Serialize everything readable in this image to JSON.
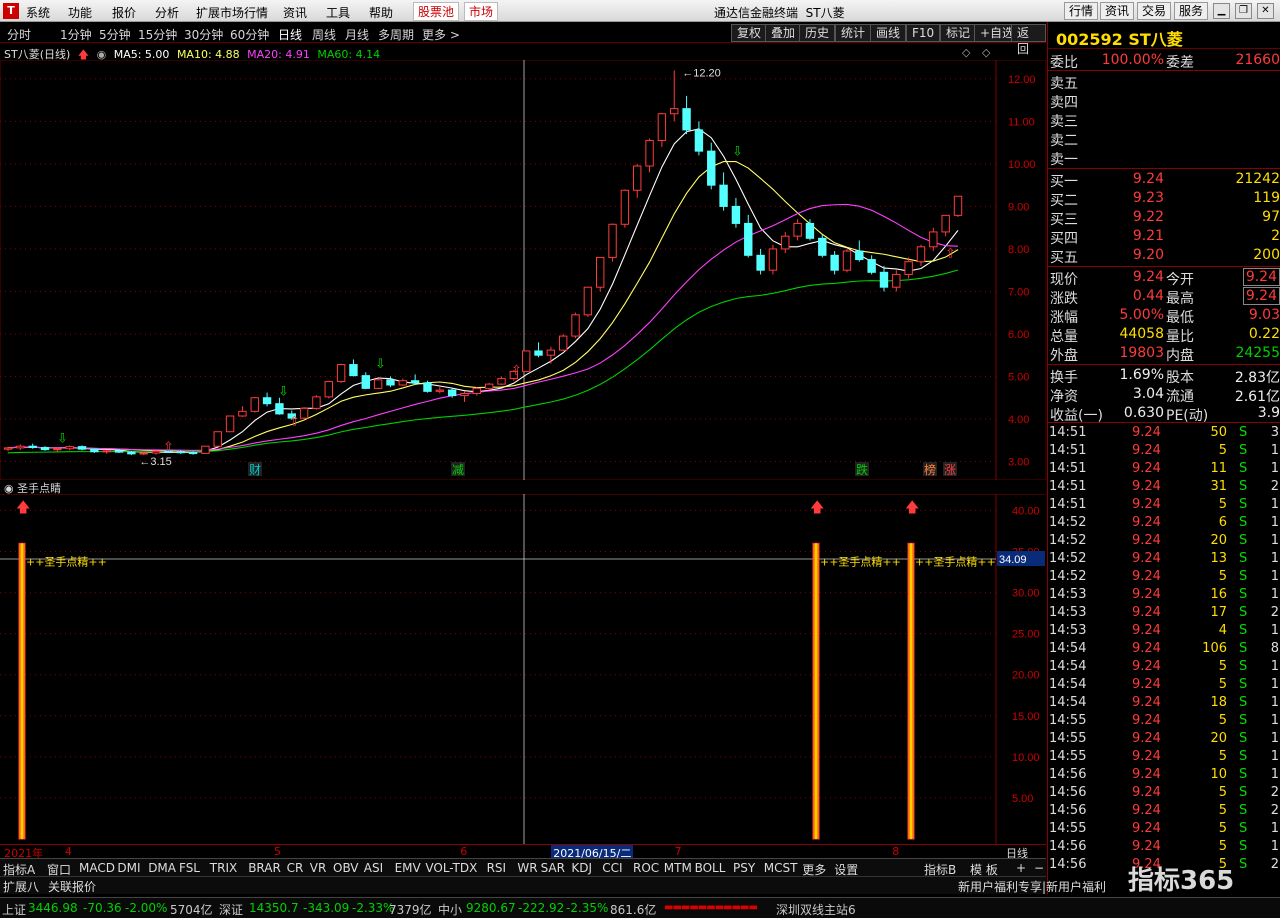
{
  "app": {
    "title": "通达信金融终端",
    "stock_name": "ST八菱"
  },
  "menu": [
    "系统",
    "功能",
    "报价",
    "分析",
    "扩展市场行情",
    "资讯",
    "工具",
    "帮助"
  ],
  "menu_red": [
    "股票池",
    "市场"
  ],
  "topbtns": [
    "行情",
    "资讯",
    "交易",
    "服务"
  ],
  "periods": [
    "分时",
    "1分钟",
    "5分钟",
    "15分钟",
    "30分钟",
    "60分钟",
    "日线",
    "周线",
    "月线",
    "多周期",
    "更多 >"
  ],
  "active_period": "日线",
  "toolbtns": [
    "复权",
    "叠加",
    "历史",
    "统计",
    "画线",
    "F10",
    "标记",
    "+自选",
    "返回"
  ],
  "chart_info": {
    "name": "ST八菱(日线)",
    "ma5": "MA5: 5.00",
    "ma10": "MA10: 4.88",
    "ma20": "MA20: 4.91",
    "ma60": "MA60: 4.14"
  },
  "colors": {
    "up": "#ff3b3b",
    "down": "#54ffff",
    "ma5": "#ffffff",
    "ma10": "#ffff64",
    "ma20": "#ff40ff",
    "ma60": "#00d000",
    "grid": "#800000"
  },
  "chart_data": {
    "type": "candlestick",
    "y_ticks": [
      12.0,
      11.0,
      10.0,
      9.0,
      8.0,
      7.0,
      6.0,
      5.0,
      4.0,
      3.0
    ],
    "ylim": [
      2.8,
      12.35
    ],
    "annotations": {
      "high": "12.20",
      "low": "3.15"
    },
    "event_labels": [
      "财",
      "减",
      "跌",
      "榜",
      "涨"
    ],
    "candles": [
      [
        3.29,
        3.35,
        3.24,
        3.32
      ],
      [
        3.32,
        3.4,
        3.27,
        3.36
      ],
      [
        3.36,
        3.42,
        3.3,
        3.33
      ],
      [
        3.33,
        3.36,
        3.25,
        3.28
      ],
      [
        3.28,
        3.33,
        3.22,
        3.3
      ],
      [
        3.3,
        3.38,
        3.26,
        3.35
      ],
      [
        3.35,
        3.38,
        3.26,
        3.29
      ],
      [
        3.29,
        3.31,
        3.2,
        3.23
      ],
      [
        3.23,
        3.27,
        3.18,
        3.25
      ],
      [
        3.25,
        3.3,
        3.2,
        3.22
      ],
      [
        3.22,
        3.25,
        3.15,
        3.18
      ],
      [
        3.18,
        3.22,
        3.15,
        3.2
      ],
      [
        3.2,
        3.26,
        3.16,
        3.24
      ],
      [
        3.24,
        3.28,
        3.2,
        3.23
      ],
      [
        3.23,
        3.26,
        3.18,
        3.21
      ],
      [
        3.21,
        3.24,
        3.16,
        3.19
      ],
      [
        3.19,
        3.36,
        3.19,
        3.36
      ],
      [
        3.36,
        3.7,
        3.36,
        3.7
      ],
      [
        3.7,
        4.07,
        3.7,
        4.07
      ],
      [
        4.07,
        4.3,
        4.05,
        4.18
      ],
      [
        4.18,
        4.52,
        4.15,
        4.5
      ],
      [
        4.5,
        4.62,
        4.3,
        4.36
      ],
      [
        4.36,
        4.5,
        4.1,
        4.12
      ],
      [
        4.12,
        4.2,
        3.98,
        4.02
      ],
      [
        4.02,
        4.28,
        4.0,
        4.25
      ],
      [
        4.25,
        4.56,
        4.22,
        4.52
      ],
      [
        4.52,
        4.9,
        4.48,
        4.88
      ],
      [
        4.88,
        5.3,
        4.85,
        5.28
      ],
      [
        5.28,
        5.4,
        5.0,
        5.02
      ],
      [
        5.02,
        5.1,
        4.7,
        4.72
      ],
      [
        4.72,
        4.95,
        4.7,
        4.92
      ],
      [
        4.92,
        5.0,
        4.75,
        4.8
      ],
      [
        4.8,
        4.95,
        4.78,
        4.9
      ],
      [
        4.9,
        5.05,
        4.8,
        4.85
      ],
      [
        4.85,
        4.9,
        4.62,
        4.65
      ],
      [
        4.65,
        4.75,
        4.6,
        4.68
      ],
      [
        4.68,
        4.72,
        4.5,
        4.55
      ],
      [
        4.55,
        4.65,
        4.4,
        4.6
      ],
      [
        4.6,
        4.75,
        4.55,
        4.72
      ],
      [
        4.72,
        4.85,
        4.68,
        4.82
      ],
      [
        4.82,
        5.0,
        4.8,
        4.95
      ],
      [
        4.95,
        5.15,
        4.9,
        5.12
      ],
      [
        5.12,
        5.6,
        5.1,
        5.6
      ],
      [
        5.6,
        5.8,
        5.45,
        5.5
      ],
      [
        5.5,
        5.7,
        5.3,
        5.62
      ],
      [
        5.62,
        6.0,
        5.6,
        5.95
      ],
      [
        5.95,
        6.5,
        5.9,
        6.45
      ],
      [
        6.45,
        7.1,
        6.4,
        7.1
      ],
      [
        7.1,
        7.8,
        7.0,
        7.8
      ],
      [
        7.8,
        8.6,
        7.7,
        8.58
      ],
      [
        8.58,
        9.4,
        8.5,
        9.38
      ],
      [
        9.38,
        10.0,
        9.2,
        9.95
      ],
      [
        9.95,
        10.6,
        9.8,
        10.55
      ],
      [
        10.55,
        11.2,
        10.4,
        11.18
      ],
      [
        11.18,
        12.2,
        11.0,
        11.3
      ],
      [
        11.3,
        11.6,
        10.7,
        10.8
      ],
      [
        10.8,
        11.0,
        10.2,
        10.3
      ],
      [
        10.3,
        10.5,
        9.4,
        9.5
      ],
      [
        9.5,
        9.8,
        8.9,
        9.0
      ],
      [
        9.0,
        9.2,
        8.5,
        8.6
      ],
      [
        8.6,
        8.8,
        7.8,
        7.85
      ],
      [
        7.85,
        8.0,
        7.4,
        7.5
      ],
      [
        7.5,
        8.1,
        7.4,
        8.0
      ],
      [
        8.0,
        8.4,
        7.9,
        8.3
      ],
      [
        8.3,
        8.7,
        8.2,
        8.6
      ],
      [
        8.6,
        8.7,
        8.2,
        8.25
      ],
      [
        8.25,
        8.35,
        7.8,
        7.85
      ],
      [
        7.85,
        7.95,
        7.4,
        7.5
      ],
      [
        7.5,
        8.0,
        7.45,
        7.95
      ],
      [
        7.95,
        8.2,
        7.7,
        7.75
      ],
      [
        7.75,
        7.85,
        7.4,
        7.45
      ],
      [
        7.45,
        7.6,
        7.0,
        7.1
      ],
      [
        7.1,
        7.5,
        7.0,
        7.4
      ],
      [
        7.4,
        7.8,
        7.3,
        7.7
      ],
      [
        7.7,
        8.1,
        7.6,
        8.05
      ],
      [
        8.05,
        8.5,
        7.95,
        8.4
      ],
      [
        8.4,
        8.8,
        8.3,
        8.79
      ],
      [
        8.79,
        9.24,
        8.75,
        9.24
      ]
    ],
    "sub": {
      "title": "圣手点睛",
      "y_ticks": [
        40.0,
        35.0,
        30.0,
        25.0,
        20.0,
        15.0,
        10.0,
        5.0
      ],
      "ylim": [
        0,
        42
      ],
      "cursor_value": "34.09",
      "signal_label": "++圣手点精++",
      "signal_indices": [
        0,
        68,
        75
      ]
    }
  },
  "date_axis": [
    {
      "label": "2021年",
      "pos": 0.004
    },
    {
      "label": "4",
      "pos": 0.062
    },
    {
      "label": "5",
      "pos": 0.262
    },
    {
      "label": "6",
      "pos": 0.44
    },
    {
      "label": "2021/06/15/二",
      "pos": 0.527,
      "hl": true
    },
    {
      "label": "7",
      "pos": 0.645
    },
    {
      "label": "8",
      "pos": 0.853
    }
  ],
  "right_axis_label": "日线",
  "indicators": [
    "指标A",
    "窗口",
    "MACD",
    "DMI",
    "DMA",
    "FSL",
    "TRIX",
    "BRAR",
    "CR",
    "VR",
    "OBV",
    "ASI",
    "EMV",
    "VOL-TDX",
    "RSI",
    "WR",
    "SAR",
    "KDJ",
    "CCI",
    "ROC",
    "MTM",
    "BOLL",
    "PSY",
    "MCST",
    "更多",
    "设置"
  ],
  "ind_right": [
    "指标B",
    "模 板",
    "+",
    "−"
  ],
  "ext": [
    "扩展八",
    "关联报价"
  ],
  "quote": {
    "code": "002592 ST八菱",
    "weibi": {
      "label": "委比",
      "value": "100.00%",
      "label2": "委差",
      "value2": "21660"
    },
    "sells": [
      "卖五",
      "卖四",
      "卖三",
      "卖二",
      "卖一"
    ],
    "buys": [
      {
        "label": "买一",
        "price": "9.24",
        "vol": "21242"
      },
      {
        "label": "买二",
        "price": "9.23",
        "vol": "119"
      },
      {
        "label": "买三",
        "price": "9.22",
        "vol": "97"
      },
      {
        "label": "买四",
        "price": "9.21",
        "vol": "2"
      },
      {
        "label": "买五",
        "price": "9.20",
        "vol": "200"
      }
    ],
    "stats": [
      {
        "l": "现价",
        "v": "9.24",
        "vc": "red",
        "l2": "今开",
        "v2": "9.24",
        "v2c": "red",
        "box": true
      },
      {
        "l": "涨跌",
        "v": "0.44",
        "vc": "red",
        "l2": "最高",
        "v2": "9.24",
        "v2c": "red",
        "box": true
      },
      {
        "l": "涨幅",
        "v": "5.00%",
        "vc": "red",
        "l2": "最低",
        "v2": "9.03",
        "v2c": "red"
      },
      {
        "l": "总量",
        "v": "44058",
        "vc": "yel",
        "l2": "量比",
        "v2": "0.22",
        "v2c": "yel"
      },
      {
        "l": "外盘",
        "v": "19803",
        "vc": "red",
        "l2": "内盘",
        "v2": "24255",
        "v2c": "grn"
      }
    ],
    "stats2": [
      {
        "l": "换手",
        "v": "1.69%",
        "vc": "wht",
        "l2": "股本",
        "v2": "2.83亿",
        "v2c": "wht"
      },
      {
        "l": "净资",
        "v": "3.04",
        "vc": "wht",
        "l2": "流通",
        "v2": "2.61亿",
        "v2c": "wht"
      },
      {
        "l": "收益(一)",
        "v": "0.630",
        "vc": "wht",
        "l2": "PE(动)",
        "v2": "3.9",
        "v2c": "wht"
      }
    ],
    "ticks": [
      [
        "14:51",
        "9.24",
        "50",
        "S",
        "3"
      ],
      [
        "14:51",
        "9.24",
        "5",
        "S",
        "1"
      ],
      [
        "14:51",
        "9.24",
        "11",
        "S",
        "1"
      ],
      [
        "14:51",
        "9.24",
        "31",
        "S",
        "2"
      ],
      [
        "14:51",
        "9.24",
        "5",
        "S",
        "1"
      ],
      [
        "14:52",
        "9.24",
        "6",
        "S",
        "1"
      ],
      [
        "14:52",
        "9.24",
        "20",
        "S",
        "1"
      ],
      [
        "14:52",
        "9.24",
        "13",
        "S",
        "1"
      ],
      [
        "14:52",
        "9.24",
        "5",
        "S",
        "1"
      ],
      [
        "14:53",
        "9.24",
        "16",
        "S",
        "1"
      ],
      [
        "14:53",
        "9.24",
        "17",
        "S",
        "2"
      ],
      [
        "14:53",
        "9.24",
        "4",
        "S",
        "1"
      ],
      [
        "14:54",
        "9.24",
        "106",
        "S",
        "8"
      ],
      [
        "14:54",
        "9.24",
        "5",
        "S",
        "1"
      ],
      [
        "14:54",
        "9.24",
        "5",
        "S",
        "1"
      ],
      [
        "14:54",
        "9.24",
        "18",
        "S",
        "1"
      ],
      [
        "14:55",
        "9.24",
        "5",
        "S",
        "1"
      ],
      [
        "14:55",
        "9.24",
        "20",
        "S",
        "1"
      ],
      [
        "14:55",
        "9.24",
        "5",
        "S",
        "1"
      ],
      [
        "14:56",
        "9.24",
        "10",
        "S",
        "1"
      ],
      [
        "14:56",
        "9.24",
        "5",
        "S",
        "2"
      ],
      [
        "14:56",
        "9.24",
        "5",
        "S",
        "2"
      ],
      [
        "14:55",
        "9.24",
        "5",
        "S",
        "1"
      ],
      [
        "14:56",
        "9.24",
        "5",
        "S",
        "1"
      ],
      [
        "14:56",
        "9.24",
        "5",
        "S",
        "2"
      ]
    ],
    "news": "新用户福利专享|新用户福利"
  },
  "status": {
    "sh": "上证",
    "sh_v": "3446.98",
    "sh_c": "-70.36",
    "sh_p": "-2.00%",
    "sh_a": "5704亿",
    "sz": "深证",
    "sz_v": "14350.7",
    "sz_c": "-343.09",
    "sz_p": "-2.33%",
    "sz_a": "7379亿",
    "zx": "中小",
    "zx_v": "9280.67",
    "zx_c": "-222.92",
    "zx_p": "-2.35%",
    "zx_a": "861.6亿",
    "server": "深圳双线主站6"
  },
  "watermark": "指标365"
}
